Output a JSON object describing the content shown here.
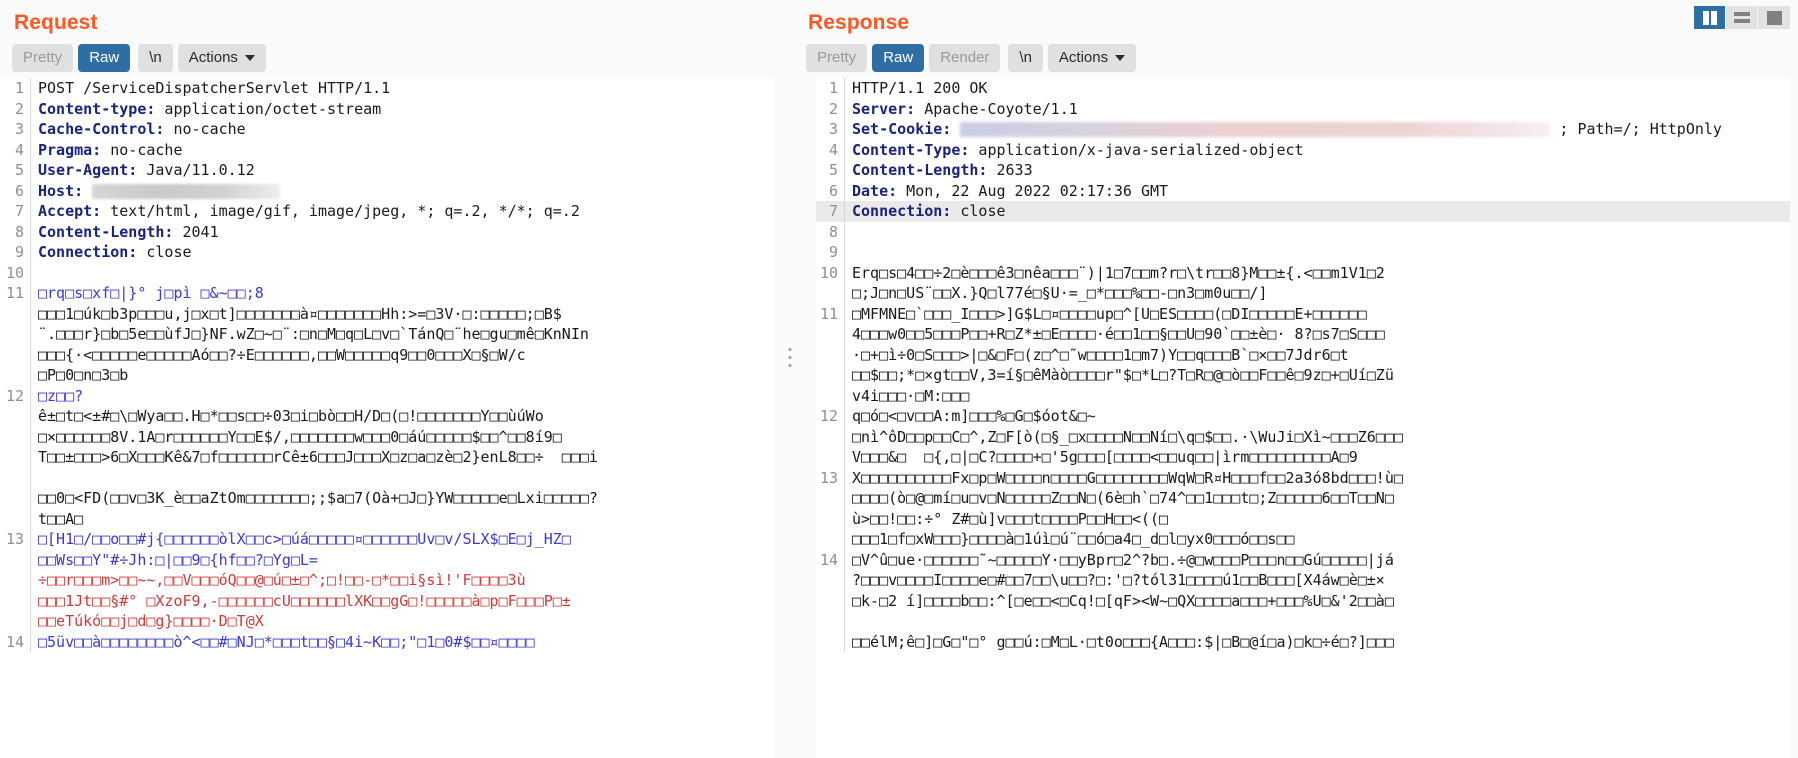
{
  "layout_toggles": [
    {
      "name": "side-by-side",
      "active": true
    },
    {
      "name": "stacked",
      "active": false
    },
    {
      "name": "single-pane",
      "active": false
    }
  ],
  "request": {
    "title": "Request",
    "tabs": [
      {
        "label": "Pretty",
        "active": false
      },
      {
        "label": "Raw",
        "active": true
      },
      {
        "label": "\\n",
        "active": false
      },
      {
        "label": "Actions",
        "active": false,
        "has_caret": true
      }
    ],
    "lines": [
      {
        "num": "1",
        "type": "start",
        "text": "POST /ServiceDispatcherServlet HTTP/1.1"
      },
      {
        "num": "2",
        "type": "header",
        "key": "Content-type",
        "value": " application/octet-stream"
      },
      {
        "num": "3",
        "type": "header",
        "key": "Cache-Control",
        "value": " no-cache"
      },
      {
        "num": "4",
        "type": "header",
        "key": "Pragma",
        "value": " no-cache"
      },
      {
        "num": "5",
        "type": "header",
        "key": "User-Agent",
        "value": " Java/11.0.12"
      },
      {
        "num": "6",
        "type": "header-redacted",
        "key": "Host",
        "value": " "
      },
      {
        "num": "7",
        "type": "header",
        "key": "Accept",
        "value": " text/html, image/gif, image/jpeg, *; q=.2, */*; q=.2"
      },
      {
        "num": "8",
        "type": "header",
        "key": "Content-Length",
        "value": " 2041"
      },
      {
        "num": "9",
        "type": "header",
        "key": "Connection",
        "value": " close"
      },
      {
        "num": "10",
        "type": "blank",
        "text": ""
      },
      {
        "num": "11",
        "type": "binary",
        "color": "blue",
        "text": "□rq□s□xf□|}° j□pì □&~□□;8"
      },
      {
        "num": "",
        "type": "binary",
        "color": "black",
        "text": "□□□1□úk□b3p□□□u,j□x□t]□□□□□□□à¤□□□□□□□Hh:>=□3V·□:□□□□□;□B$"
      },
      {
        "num": "",
        "type": "binary",
        "color": "black",
        "text": "¨.□□□r}□b□5e□□ùfJ□}NF.wZ□~□¨:□n□M□q□L□v□`TánQ□¨he□gu□mê□KnNIn"
      },
      {
        "num": "",
        "type": "binary",
        "color": "black",
        "text": "□□□{·<□□□□□e□□□□□Aó□□?÷E□□□□□□,□□W□□□□□q9□□0□□□X□§□W/c"
      },
      {
        "num": "",
        "type": "binary",
        "color": "black",
        "text": "□P□0□n□3□b"
      },
      {
        "num": "12",
        "type": "binary",
        "color": "blue",
        "selected": true,
        "text": "□z□□?"
      },
      {
        "num": "",
        "type": "binary",
        "color": "black",
        "text": "ê±□t□<±#□\\□Wya□□.H□*□□s□□÷03□i□bò□□H/D□(□!□□□□□□□Y□□ùúWo"
      },
      {
        "num": "",
        "type": "binary",
        "color": "black",
        "text": "□×□□□□□□8V.1A□r□□□□□□Y□□E$/,□□□□□□□w□□□0□áú□□□□□$□□^□□8í9□"
      },
      {
        "num": "",
        "type": "binary",
        "color": "black",
        "text": "T□□±□□□>6□X□□□Kê&7□f□□□□□□rCê±6□□□J□□□X□z□a□zè□2}enL8□□÷  □□□i"
      },
      {
        "num": "",
        "type": "blank",
        "text": ""
      },
      {
        "num": "",
        "type": "binary",
        "color": "black",
        "text": "□□0□<FD(□□v□3K_è□□aZtOm□□□□□□□;;$a□7(Oà+□J□}YW□□□□□e□Lxi□□□□□?"
      },
      {
        "num": "",
        "type": "binary",
        "color": "black",
        "text": "t□□A□"
      },
      {
        "num": "13",
        "type": "binary",
        "color": "blue",
        "text": "□[H1□/□□o□□#j{□□□□□□òlX□□c>□úá□□□□□¤□□□□□□Uv□v/SLX$□E□j_HZ□"
      },
      {
        "num": "",
        "type": "binary",
        "color": "blue",
        "text": "□□Ws□□Y\"#÷Jh:□|□□9□{hf□□?□Yg□L="
      },
      {
        "num": "",
        "type": "binary",
        "color": "red",
        "text": "÷□□r□□□m>□□~~,□□V□□□óQ□□@□ú□±□^;□!□□-□*□□i§sì!'F□□□□3ù"
      },
      {
        "num": "",
        "type": "binary",
        "color": "red",
        "text": "□□□1Jt□□§#° □XzoF9,-□□□□□□cU□□□□□□lXK□□gG□!□□□□□à□p□F□□□P□±"
      },
      {
        "num": "",
        "type": "binary",
        "color": "red",
        "text": "□□eTúkó□□j□d□g}□□□□·D□T@X"
      },
      {
        "num": "14",
        "type": "binary",
        "color": "blue",
        "text": "□5üv□□à□□□□□□□□ò^<□□#□NJ□*□□□t□□§□4i~K□□;\"□1□0#$□□¤□□□□"
      }
    ]
  },
  "response": {
    "title": "Response",
    "tabs": [
      {
        "label": "Pretty",
        "active": false
      },
      {
        "label": "Raw",
        "active": true
      },
      {
        "label": "Render",
        "active": false
      },
      {
        "label": "\\n",
        "active": false
      },
      {
        "label": "Actions",
        "active": false,
        "has_caret": true
      }
    ],
    "lines": [
      {
        "num": "1",
        "type": "start",
        "text": "HTTP/1.1 200 OK"
      },
      {
        "num": "2",
        "type": "header",
        "key": "Server",
        "value": " Apache-Coyote/1.1"
      },
      {
        "num": "3",
        "type": "header-cookie",
        "key": "Set-Cookie",
        "value": " ",
        "tail": " ; Path=/; HttpOnly"
      },
      {
        "num": "4",
        "type": "header",
        "key": "Content-Type",
        "value": " application/x-java-serialized-object"
      },
      {
        "num": "5",
        "type": "header",
        "key": "Content-Length",
        "value": " 2633"
      },
      {
        "num": "6",
        "type": "header",
        "key": "Date",
        "value": " Mon, 22 Aug 2022 02:17:36 GMT"
      },
      {
        "num": "7",
        "type": "header",
        "key": "Connection",
        "value": " close",
        "highlight": true
      },
      {
        "num": "8",
        "type": "blank",
        "text": ""
      },
      {
        "num": "9",
        "type": "blank",
        "text": ""
      },
      {
        "num": "10",
        "type": "binary",
        "color": "black",
        "text": "Erq□s□4□□÷2□è□□□ê3□nêa□□□¨)|1□7□□m?r□\\tr□□8}M□□±{.<□□m1V1□2"
      },
      {
        "num": "",
        "type": "binary",
        "color": "black",
        "text": "□;J□n□US¨□□X.}Q□l77é□§U·=_□*□□□%□□-□n3□m0u□□/]"
      },
      {
        "num": "11",
        "type": "binary",
        "color": "black",
        "text": "□MFMNE□`□□□_I□□□>]G$L□¤□□□□up□^[U□ES□□□□(□DI□□□□□E+□□□□□□"
      },
      {
        "num": "",
        "type": "binary",
        "color": "black",
        "text": "4□□□w0□□5□□□P□□+R□Z*±□E□□□□·é□□1□□§□□U□90`□□±è□· 8?□s7□S□□□"
      },
      {
        "num": "",
        "type": "binary",
        "color": "black",
        "text": "·□+□ì÷0□S□□□>|□&□F□(z□^□˜w□□□□1□m7)Y□□q□□□B`□×□□7Jdr6□t"
      },
      {
        "num": "",
        "type": "binary",
        "color": "black",
        "text": "□□$□□;*□×gt□□V,3=í§□êMàò□□□□r\"$□*L□?T□R□@□ò□□F□□ê□9z□+□Uí□Zü"
      },
      {
        "num": "",
        "type": "binary",
        "color": "black",
        "text": "v4i□□□·□M:□□□"
      },
      {
        "num": "12",
        "type": "binary",
        "color": "black",
        "text": "q□ó□<□v□□A:m]□□□%□G□$óot&□~"
      },
      {
        "num": "",
        "type": "binary",
        "color": "black",
        "text": "□nì^ôD□□p□□C□^,Z□F[ò(□§_□x□□□□N□□Ní□\\q□$□□.·\\WuJi□Xì~□□□Z6□□□"
      },
      {
        "num": "",
        "type": "binary",
        "color": "black",
        "text": "V□□□&□  □{,□|□C?□□□□+□'5g□□□[□□□□<□□uq□□|ìrm□□□□□□□□□A□9"
      },
      {
        "num": "13",
        "type": "binary",
        "color": "black",
        "text": "X□□□□□□□□□□Fx□p□W□□□□n□□□□G□□□□□□□□WqW□R¤H□□□f□□2a3ó8bd□□□!ù□"
      },
      {
        "num": "",
        "type": "binary",
        "color": "black",
        "text": "□□□□(ò□@□mí□u□v□N□□□□□Z□□N□(6è□h`□74^□□1□□□t□;Z□□□□□6□□T□□N□"
      },
      {
        "num": "",
        "type": "binary",
        "color": "black",
        "text": "ù>□□!□□:÷° Z#□ù]v□□□t□□□□P□□H□□<((□"
      },
      {
        "num": "",
        "type": "binary",
        "color": "black",
        "text": "□□□1□f□xW□□□}□□□□à□1úì□ú¨□□ó□a4□_d□l□yx0□□□ó□□s□□"
      },
      {
        "num": "14",
        "type": "binary",
        "color": "black",
        "text": "□V^û□ue·□□□□□□˜~□□□□□Y·□□yBpr□2^?b□.÷@□w□□□P□□□n□□Gú□□□□□|já"
      },
      {
        "num": "",
        "type": "binary",
        "color": "black",
        "text": "?□□□v□□□□I□□□□e□#□□7□□\\u□□?□:'□?tól31□□□□ú1□□B□□□[X4áw□è□±×"
      },
      {
        "num": "",
        "type": "binary",
        "color": "black",
        "text": "□k-□2 í]□□□□b□□:^[□e□□<□Cq!□[qF><W~□QX□□□□a□□□+□□□%U□&'2□□à□"
      },
      {
        "num": "",
        "type": "blank",
        "text": ""
      },
      {
        "num": "",
        "type": "binary",
        "color": "black",
        "text": "□□élM;ê□]□G□\"□° g□□ú:□M□L·□t0o□□□{A□□□:$|□B□@í□a)□k□÷é□?]□□□"
      }
    ]
  }
}
